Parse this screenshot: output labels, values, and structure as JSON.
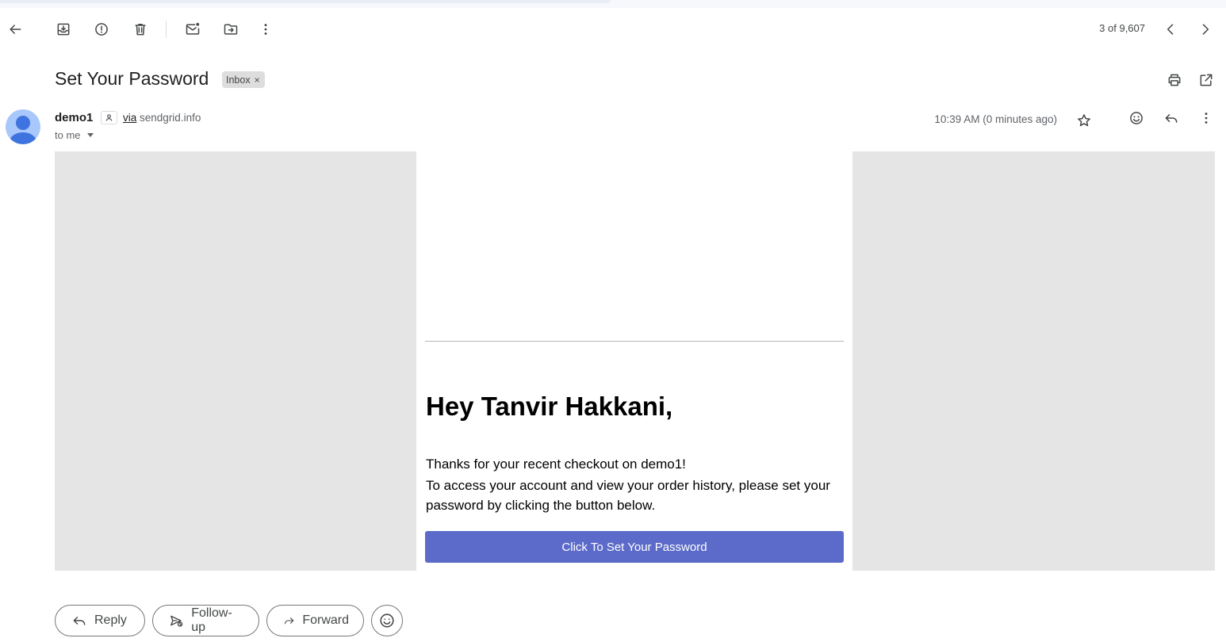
{
  "toolbar": {
    "back_icon": "arrow-left-icon",
    "archive_icon": "archive-icon",
    "spam_icon": "report-spam-icon",
    "delete_icon": "trash-icon",
    "mark_unread_icon": "mark-unread-icon",
    "move_icon": "move-to-folder-icon",
    "more_icon": "more-vert-icon",
    "pager_text": "3 of 9,607",
    "prev_icon": "chevron-left-icon",
    "next_icon": "chevron-right-icon"
  },
  "thread": {
    "subject": "Set Your Password",
    "label": "Inbox",
    "label_remove": "×",
    "print_icon": "print-icon",
    "open_new_window_icon": "open-in-new-icon"
  },
  "message": {
    "sender_name": "demo1",
    "via_word": "via",
    "via_domain": "sendgrid.info",
    "recipient_text": "to me",
    "timestamp": "10:39 AM (0 minutes ago)",
    "star_icon": "star-outline-icon",
    "emoji_icon": "emoji-react-icon",
    "reply_icon": "reply-icon",
    "more_icon": "more-vert-icon"
  },
  "email_content": {
    "greeting": "Hey Tanvir Hakkani,",
    "line1": "Thanks for your recent checkout on demo1!",
    "line2": "To access your account and view your order history, please set your password by clicking the button below.",
    "cta_label": "Click To Set Your Password",
    "cta_color": "#5c6bc9"
  },
  "actions": {
    "reply_label": "Reply",
    "followup_label": "Follow-up",
    "forward_label": "Forward"
  }
}
